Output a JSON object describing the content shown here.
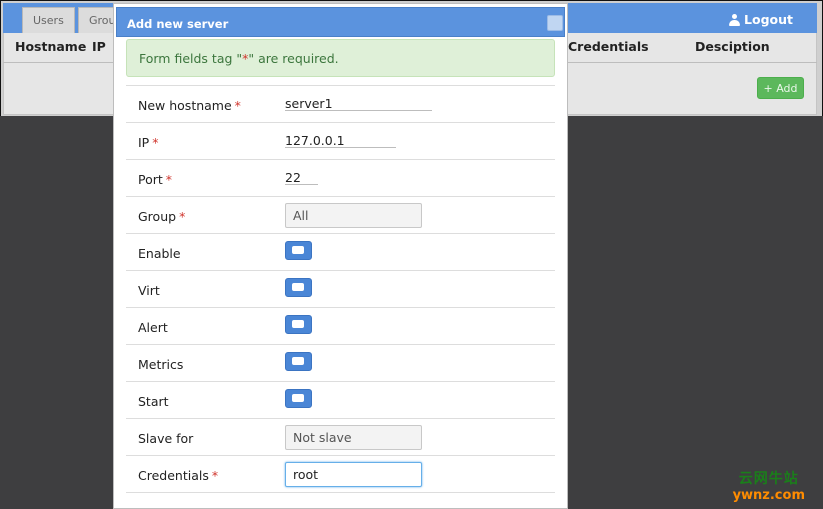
{
  "tabs": [
    {
      "label": "Users"
    },
    {
      "label": "Groups"
    }
  ],
  "header": {
    "logout_label": "Logout"
  },
  "table": {
    "columns": [
      "Hostname",
      "IP",
      "Credentials",
      "Desciption"
    ],
    "add_button": "+ Add"
  },
  "modal": {
    "title": "Add new server",
    "notice": {
      "before": "Form fields tag \"",
      "star": "*",
      "after": "\" are required."
    },
    "fields": {
      "hostname": {
        "label": "New hostname",
        "value": "server1"
      },
      "ip": {
        "label": "IP",
        "value": "127.0.0.1"
      },
      "port": {
        "label": "Port",
        "value": "22"
      },
      "group": {
        "label": "Group",
        "value": "All"
      },
      "enable": {
        "label": "Enable"
      },
      "virt": {
        "label": "Virt"
      },
      "alert": {
        "label": "Alert"
      },
      "metrics": {
        "label": "Metrics"
      },
      "start": {
        "label": "Start"
      },
      "slave_for": {
        "label": "Slave for",
        "value": "Not slave"
      },
      "credentials": {
        "label": "Credentials",
        "value": "root"
      }
    },
    "required_mark": "*"
  },
  "watermark": {
    "cn": "云网牛站",
    "en": "ywnz.com"
  },
  "colors": {
    "accent": "#5b93de",
    "success_bg": "#dff0d8",
    "required": "#d0342c",
    "add_button": "#5cb85c"
  }
}
